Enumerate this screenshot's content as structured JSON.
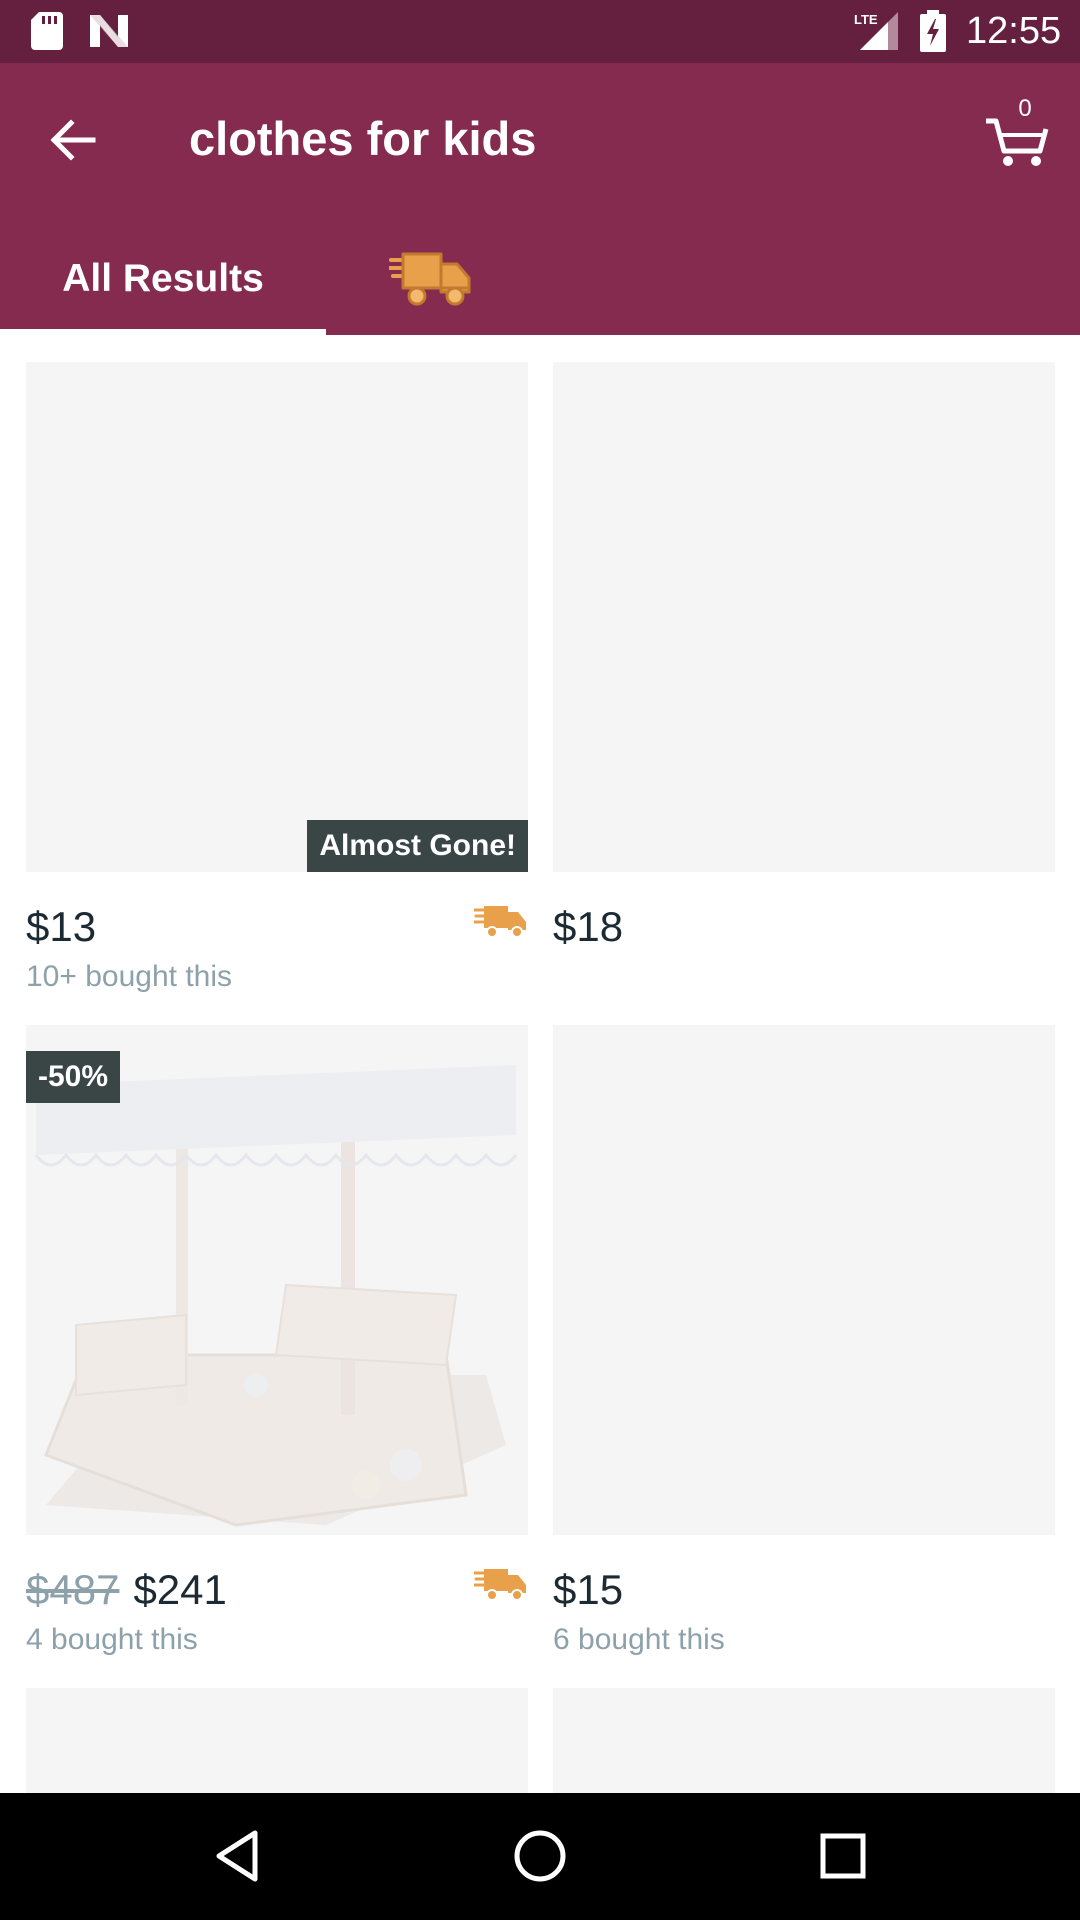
{
  "status_bar": {
    "time": "12:55",
    "network": "LTE",
    "icons": [
      "sd-card-icon",
      "n-notification-icon",
      "lte-signal-icon",
      "battery-charging-icon"
    ]
  },
  "header": {
    "search_query": "clothes for kids",
    "cart_count": "0",
    "back_icon": "arrow-back-icon",
    "cart_icon": "cart-icon"
  },
  "tabs": [
    {
      "label": "All Results",
      "selected": true
    },
    {
      "label": "",
      "icon": "fast-shipping-truck-icon",
      "selected": false
    }
  ],
  "colors": {
    "status_bar": "#66203f",
    "app_bar": "#852b4f",
    "truck_orange": "#e8a04a",
    "badge_bg": "#3a4646",
    "price_text": "#1c2a33",
    "muted_text": "#8da1ab",
    "placeholder": "#f5f5f5"
  },
  "products": [
    {
      "price": "$13",
      "old_price": "",
      "sold": "10+ bought this",
      "badge": "Almost Gone!",
      "fast_shipping": true
    },
    {
      "price": "$18",
      "old_price": "",
      "sold": "",
      "badge": "",
      "fast_shipping": false
    },
    {
      "price": "$241",
      "old_price": "$487",
      "sold": "4 bought this",
      "badge": "-50%",
      "fast_shipping": true,
      "image": "sandbox-with-canopy"
    },
    {
      "price": "$15",
      "old_price": "",
      "sold": "6 bought this",
      "badge": "",
      "fast_shipping": false
    }
  ],
  "nav_bar": {
    "icons": [
      "back-triangle-icon",
      "home-circle-icon",
      "recents-square-icon"
    ]
  }
}
